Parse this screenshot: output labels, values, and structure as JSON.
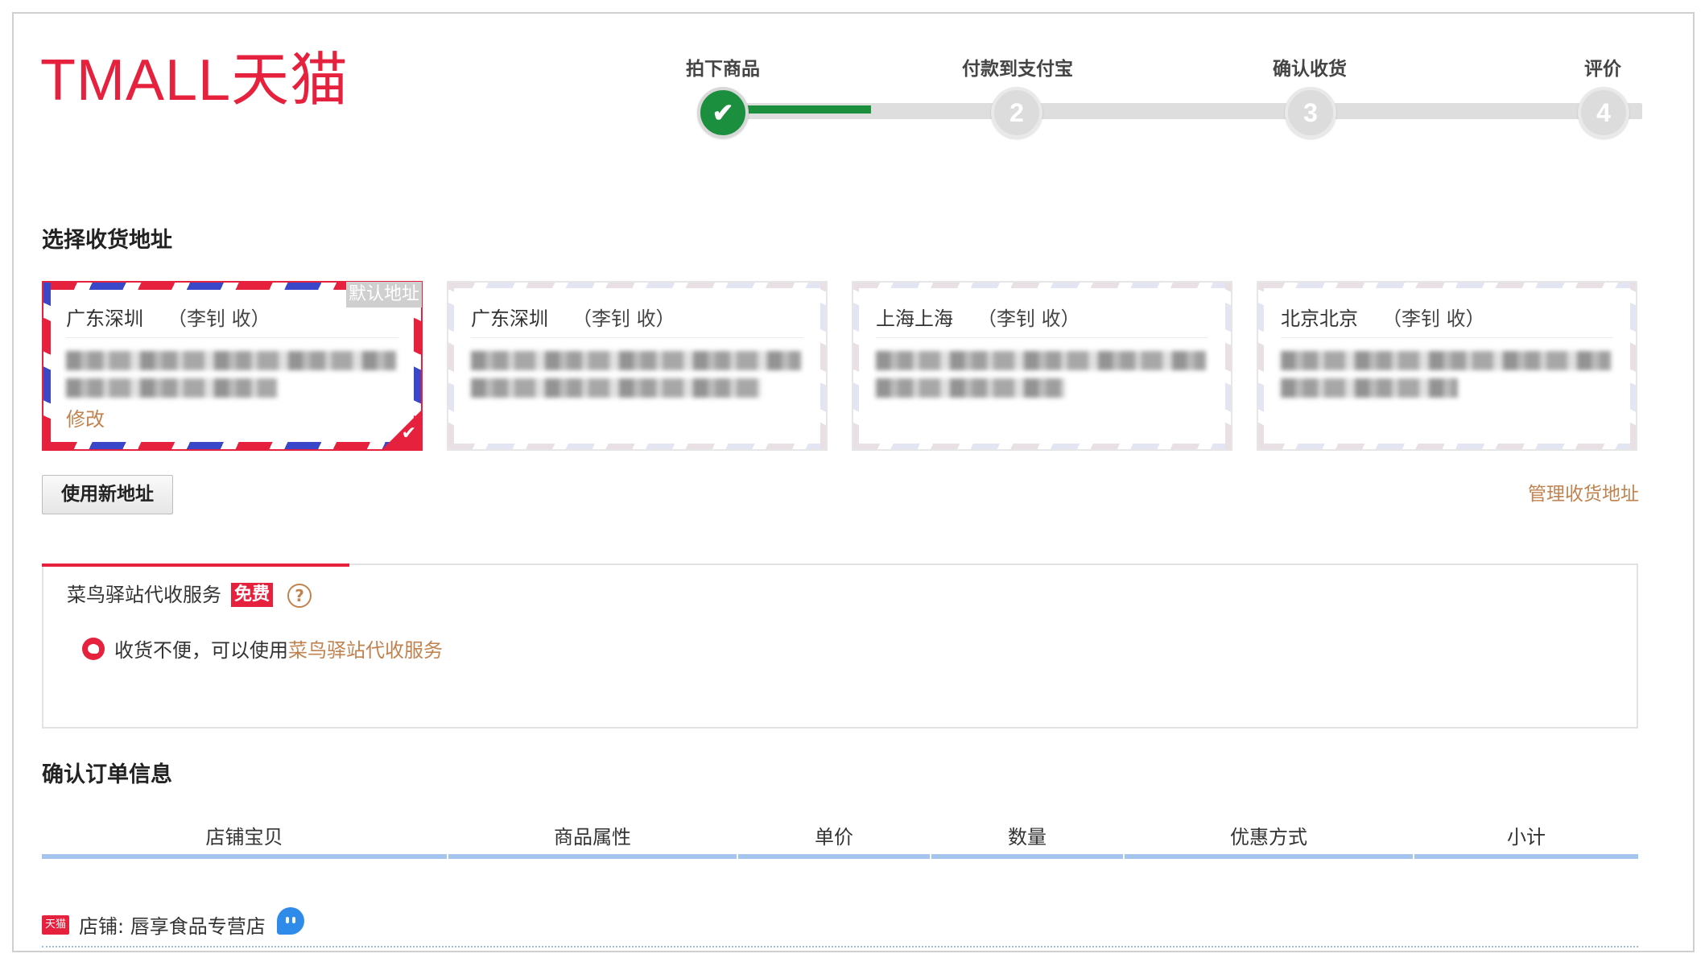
{
  "logo": {
    "text": "TMALL天猫"
  },
  "progress": {
    "steps": [
      {
        "label": "拍下商品",
        "number": "",
        "status": "done"
      },
      {
        "label": "付款到支付宝",
        "number": "2",
        "status": "pending"
      },
      {
        "label": "确认收货",
        "number": "3",
        "status": "pending"
      },
      {
        "label": "评价",
        "number": "4",
        "status": "pending"
      }
    ],
    "check_glyph": "✔"
  },
  "address_section": {
    "title": "选择收货地址",
    "cards": [
      {
        "region": "广东深圳",
        "recipient": "（李钊 收）",
        "default_badge": "默认地址",
        "edit_label": "修改",
        "selected": true
      },
      {
        "region": "广东深圳",
        "recipient": "（李钊 收）",
        "selected": false
      },
      {
        "region": "上海上海",
        "recipient": "（李钊 收）",
        "selected": false
      },
      {
        "region": "北京北京",
        "recipient": "（李钊 收）",
        "selected": false
      }
    ],
    "selected_check": "✔",
    "new_address_button": "使用新地址",
    "manage_link": "管理收货地址"
  },
  "cainiao": {
    "title": "菜鸟驿站代收服务",
    "badge": "免费",
    "help": "?",
    "message": "收货不便，可以使用",
    "link": "菜鸟驿站代收服务"
  },
  "order_section": {
    "title": "确认订单信息",
    "columns": [
      "店铺宝贝",
      "商品属性",
      "单价",
      "数量",
      "优惠方式",
      "小计"
    ],
    "shop": {
      "logo_text": "天猫",
      "name": "店铺: 唇享食品专营店"
    }
  },
  "colors": {
    "brand": "#e6213e",
    "done": "#1c8f3f",
    "link": "#c0834f",
    "table_rule": "#a5c4f0"
  }
}
